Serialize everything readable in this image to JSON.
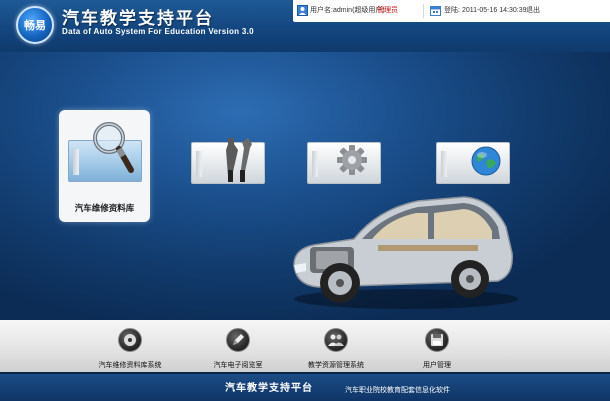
{
  "header": {
    "logo_text": "畅易",
    "title_cn": "汽车教学支持平台",
    "title_en": "Data of Auto System For Education Version 3.0"
  },
  "user_bar": {
    "name_label": "用户名:",
    "name_value": "admin(超级用户)",
    "role": "管理员",
    "date_label": "登陆:",
    "date_value": "2011-05-16 14:30:39",
    "logout": "退出"
  },
  "modules": [
    {
      "label": "汽车维修资料库",
      "icon": "magnifier-icon",
      "active": true
    },
    {
      "label": "",
      "icon": "tools-icon",
      "active": false
    },
    {
      "label": "",
      "icon": "gear-icon",
      "active": false
    },
    {
      "label": "",
      "icon": "globe-icon",
      "active": false
    }
  ],
  "bottom_nav": [
    {
      "label": "汽车维修资料库系统",
      "icon": "disc-icon"
    },
    {
      "label": "汽车电子阅览室",
      "icon": "pen-icon"
    },
    {
      "label": "教学资源管理系统",
      "icon": "users-icon"
    },
    {
      "label": "用户管理",
      "icon": "save-icon"
    }
  ],
  "footer": {
    "title": "汽车教学支持平台",
    "subtitle": "汽车职业院校教育配套信息化软件"
  },
  "colors": {
    "header_bg": "#14467f",
    "stage_bg": "#1b4f8c",
    "role_red": "#d01010",
    "footer_bg": "#0f3566"
  }
}
